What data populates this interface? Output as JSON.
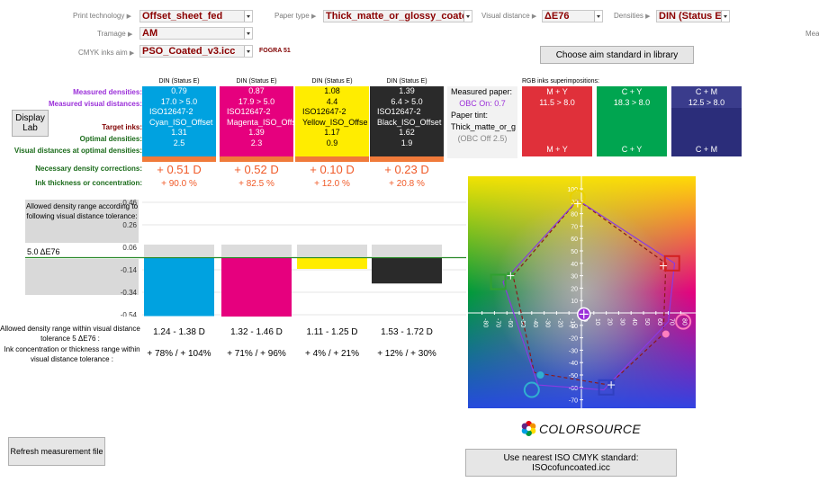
{
  "top": {
    "print_technology_label": "Print technology",
    "print_technology_value": "Offset_sheet_fed",
    "paper_type_label": "Paper type",
    "paper_type_value": "Thick_matte_or_glossy_coated",
    "visual_distance_label": "Visual distance",
    "visual_distance_value": "ΔE76",
    "densities_label": "Densities",
    "densities_value": "DIN (Status E)",
    "tramage_label": "Tramage",
    "tramage_value": "AM",
    "cmyk_aim_label": "CMYK inks aim",
    "cmyk_aim_value": "PSO_Coated_v3.icc",
    "fogra_label": "FOGRA 51",
    "cut_label": "Mea",
    "arrow_glyph": "▶",
    "choose_aim_button": "Choose aim standard in library"
  },
  "row_labels": {
    "measured_densities": "Measured densities:",
    "measured_visual": "Measured visual distances:",
    "target_inks": "Target inks:",
    "optimal_densities": "Optimal densities:",
    "visual_at_optimal": "Visual distances at optimal densities:",
    "necessary_corrections": "Necessary density corrections:",
    "ink_thickness": "Ink thickness or concentration:"
  },
  "display_lab_button": "Display Lab",
  "inks": [
    {
      "name": "cyan",
      "head": "DIN (Status E)",
      "color": "#00a2e0",
      "text": "#ffffff",
      "density": "0.79",
      "visual": "17.0 > 5.0",
      "standard": "ISO12647-2",
      "target": "Cyan_ISO_Offset",
      "optimal": "1.31",
      "visual_opt": "2.5",
      "correction": "+ 0.51 D",
      "thickness": "+ 90.0 %",
      "range": "1.24 - 1.38 D",
      "conc": "+ 78% / + 104%",
      "bar_value": -0.52
    },
    {
      "name": "magenta",
      "head": "DIN (Status E)",
      "color": "#e6007e",
      "text": "#ffffff",
      "density": "0.87",
      "visual": "17.9 > 5.0",
      "standard": "ISO12647-2",
      "target": "Magenta_ISO_Offs",
      "optimal": "1.39",
      "visual_opt": "2.3",
      "correction": "+ 0.52 D",
      "thickness": "+ 82.5 %",
      "range": "1.32 - 1.46 D",
      "conc": "+ 71% / + 96%",
      "bar_value": -0.53
    },
    {
      "name": "yellow",
      "head": "DIN (Status E)",
      "color": "#ffed00",
      "text": "#000000",
      "density": "1.08",
      "visual": "4.4",
      "standard": "ISO12647-2",
      "target": "Yellow_ISO_Offse",
      "optimal": "1.17",
      "visual_opt": "0.9",
      "correction": "+ 0.10 D",
      "thickness": "+ 12.0 %",
      "range": "1.11 - 1.25 D",
      "conc": "+ 4% / + 21%",
      "bar_value": -0.1
    },
    {
      "name": "black",
      "head": "DIN (Status E)",
      "color": "#2a2a2a",
      "text": "#ffffff",
      "density": "1.39",
      "visual": "6.4 > 5.0",
      "standard": "ISO12647-2",
      "target": "Black_ISO_Offset",
      "optimal": "1.62",
      "visual_opt": "1.9",
      "correction": "+ 0.23 D",
      "thickness": "+ 20.8 %",
      "range": "1.53 - 1.72 D",
      "conc": "+ 12% / + 30%",
      "bar_value": -0.23
    }
  ],
  "paper": {
    "measured_paper_label": "Measured paper:",
    "obc_on": "OBC On: 0.7",
    "paper_tint_label": "Paper tint:",
    "paper_tint_value": "Thick_matte_or_g",
    "obc_off": "(OBC Off 2.5)"
  },
  "rgb": {
    "title": "RGB inks superimpositions:",
    "items": [
      {
        "name": "red",
        "top": "M + Y",
        "value": "11.5 > 8.0",
        "bottom": "M + Y",
        "color_top": "#e0303a",
        "color_bottom": "#e0303a"
      },
      {
        "name": "green",
        "top": "C + Y",
        "value": "18.3 > 8.0",
        "bottom": "C + Y",
        "color_top": "#00a550",
        "color_bottom": "#00a550"
      },
      {
        "name": "blue",
        "top": "C + M",
        "value": "12.5 > 8.0",
        "bottom": "C + M",
        "color_top": "#3a3c8c",
        "color_bottom": "#2b2d7a"
      }
    ]
  },
  "tolerance_box": {
    "text": "Allowed density range according to following visual distance tolerance:",
    "value": "5.0 ΔE76"
  },
  "bar_axis": {
    "ticks": [
      "0.46",
      "0.26",
      "0.06",
      "-0.14",
      "-0.34",
      "-0.54"
    ]
  },
  "bottom_labels": {
    "range_label": "Allowed density range within visual distance tolerance 5 ΔE76 :",
    "conc_label": "Ink concentration or thickness range within visual distance tolerance :"
  },
  "refresh_button": "Refresh measurement file",
  "nearest_button": "Use nearest ISO CMYK standard: ISOcofuncoated.icc",
  "brand": "COLORSOURCE",
  "chart_data": {
    "type": "scatter",
    "x_ticks": [
      "-80",
      "-70",
      "-60",
      "-50",
      "-40",
      "-30",
      "-20",
      "-10",
      "0",
      "10",
      "20",
      "30",
      "40",
      "50",
      "60",
      "70",
      "80"
    ],
    "y_ticks": [
      "100",
      "90",
      "80",
      "70",
      "60",
      "50",
      "40",
      "30",
      "20",
      "10",
      "0",
      "-10",
      "-20",
      "-30",
      "-40",
      "-50",
      "-60",
      "-70",
      "-80"
    ],
    "xlim": [
      -85,
      85
    ],
    "ylim": [
      -85,
      105
    ],
    "series": [
      {
        "points": [
          [
            -3,
            91
          ],
          [
            75,
            40
          ],
          [
            70,
            -7
          ],
          [
            18,
            -62
          ],
          [
            -35,
            -58
          ],
          [
            -63,
            25
          ],
          [
            -3,
            91
          ]
        ],
        "style": "measured"
      },
      {
        "points": [
          [
            -3,
            91
          ],
          [
            68,
            40
          ],
          [
            66,
            -17
          ],
          [
            22,
            -58
          ],
          [
            -38,
            -48
          ],
          [
            -55,
            30
          ],
          [
            -3,
            91
          ]
        ],
        "style": "target"
      }
    ],
    "markers": [
      {
        "kind": "circle",
        "x": -3,
        "y": 93,
        "color": "#e8d000"
      },
      {
        "kind": "plus",
        "x": -3,
        "y": 88,
        "color": "#e8d000"
      },
      {
        "kind": "square",
        "x": 73,
        "y": 40,
        "color": "#d22020"
      },
      {
        "kind": "plus",
        "x": 66,
        "y": 38,
        "color": "#d22020"
      },
      {
        "kind": "circle",
        "x": 82,
        "y": -7,
        "color": "#ff7fbf"
      },
      {
        "kind": "dot",
        "x": 68,
        "y": -17,
        "color": "#ff7fbf"
      },
      {
        "kind": "square",
        "x": 20,
        "y": -60,
        "color": "#3040c0"
      },
      {
        "kind": "plus",
        "x": 24,
        "y": -58,
        "color": "#3040c0"
      },
      {
        "kind": "circle",
        "x": -40,
        "y": -62,
        "color": "#30b0d0"
      },
      {
        "kind": "dot",
        "x": -33,
        "y": -50,
        "color": "#30b0d0"
      },
      {
        "kind": "square",
        "x": -67,
        "y": 25,
        "color": "#30a030"
      },
      {
        "kind": "plus",
        "x": -57,
        "y": 30,
        "color": "#30a030"
      },
      {
        "kind": "target",
        "x": 2,
        "y": -1,
        "color": "#9b30d9"
      }
    ]
  }
}
